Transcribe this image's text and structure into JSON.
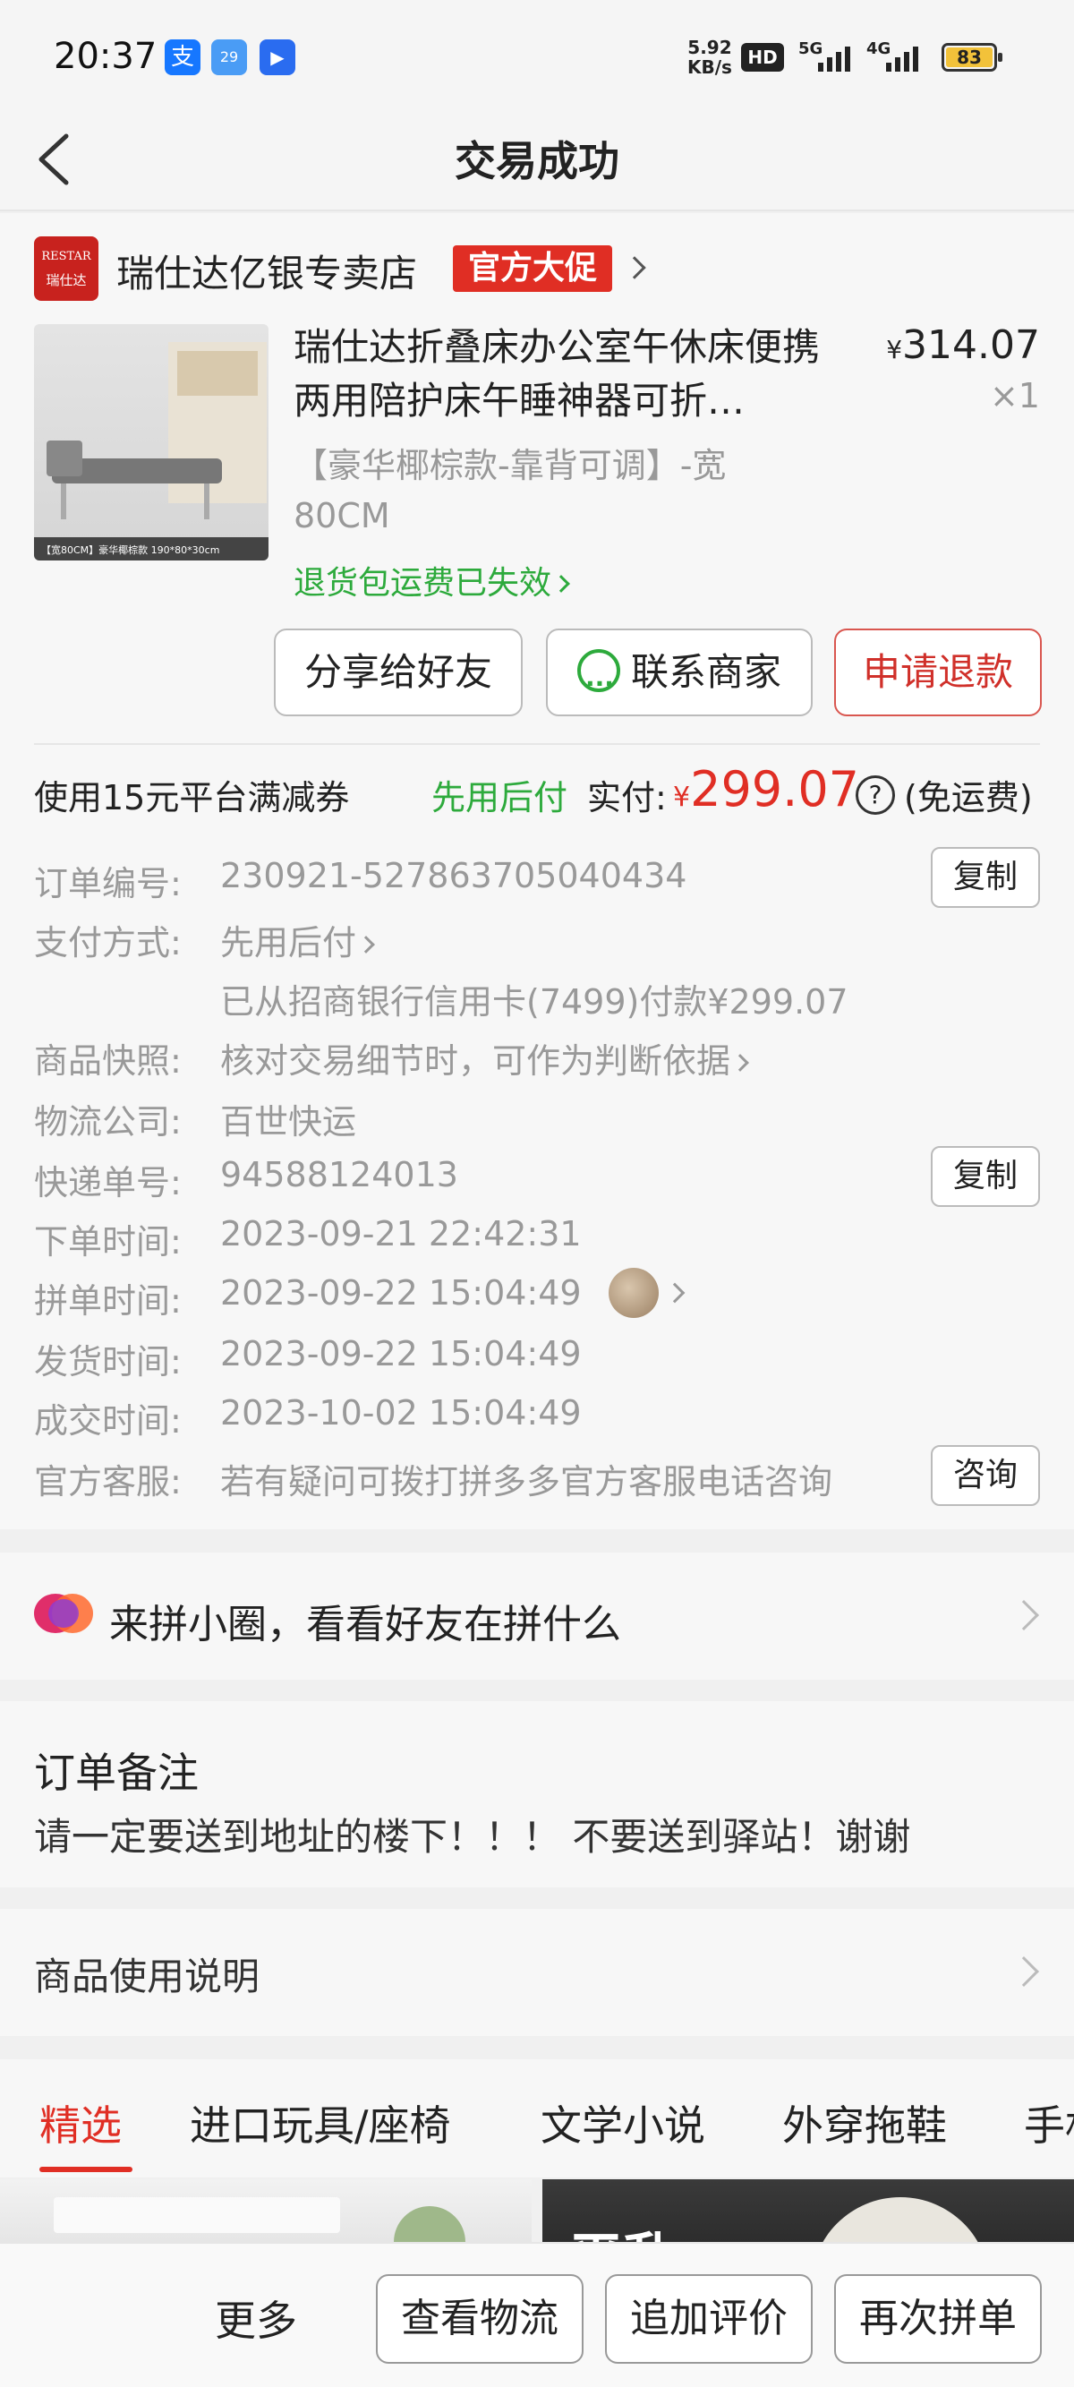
{
  "status_bar": {
    "time": "20:37",
    "apps": [
      "支",
      "29",
      "▶"
    ],
    "speed_value": "5.92",
    "speed_unit": "KB/s",
    "hd": "HD",
    "net1": "5G",
    "net2": "4G",
    "battery": "83"
  },
  "header": {
    "title": "交易成功"
  },
  "shop": {
    "logo_text1": "RESTAR",
    "logo_text2": "瑞仕达",
    "name": "瑞仕达亿银专卖店",
    "promo": "官方大促"
  },
  "product": {
    "title": "瑞仕达折叠床办公室午休床便携两用陪护床午睡神器可折…",
    "price_symbol": "¥",
    "price": "314.07",
    "qty": "×1",
    "spec": "【豪华椰棕款-靠背可调】-宽80CM",
    "return_note": "退货包运费已失效",
    "img_caption": "【宽80CM】豪华椰棕款    190*80*30cm"
  },
  "actions": {
    "share": "分享给好友",
    "contact": "联系商家",
    "refund": "申请退款"
  },
  "payment": {
    "coupon": "使用15元平台满减券",
    "pay_later": "先用后付",
    "paid_label": "实付:",
    "currency": "¥",
    "paid_amount": "299.07",
    "help": "?",
    "free_shipping": "(免运费)"
  },
  "order_info": {
    "order_no_label": "订单编号:",
    "order_no": "230921-527863705040434",
    "copy": "复制",
    "pay_method_label": "支付方式:",
    "pay_method": "先用后付",
    "pay_detail": "已从招商银行信用卡(7499)付款¥299.07",
    "snapshot_label": "商品快照:",
    "snapshot": "核对交易细节时，可作为判断依据",
    "logistics_label": "物流公司:",
    "logistics": "百世快运",
    "tracking_label": "快递单号:",
    "tracking_no": "94588124013",
    "order_time_label": "下单时间:",
    "order_time": "2023-09-21 22:42:31",
    "group_time_label": "拼单时间:",
    "group_time": "2023-09-22 15:04:49",
    "ship_time_label": "发货时间:",
    "ship_time": "2023-09-22 15:04:49",
    "deal_time_label": "成交时间:",
    "deal_time": "2023-10-02 15:04:49",
    "service_label": "官方客服:",
    "service": "若有疑问可拨打拼多多官方客服电话咨询",
    "consult": "咨询"
  },
  "circle": {
    "text": "来拼小圈，看看好友在拼什么"
  },
  "remark": {
    "title": "订单备注",
    "text": "请一定要送到地址的楼下！！！ 不要送到驿站！谢谢"
  },
  "instructions": {
    "text": "商品使用说明"
  },
  "tabs": [
    "精选",
    "进口玩具/座椅",
    "文学小说",
    "外穿拖鞋",
    "手机"
  ],
  "feed": {
    "banner_text": "平乱"
  },
  "bottom_bar": {
    "more": "更多",
    "logistics": "查看物流",
    "review": "追加评价",
    "reorder": "再次拼单"
  }
}
